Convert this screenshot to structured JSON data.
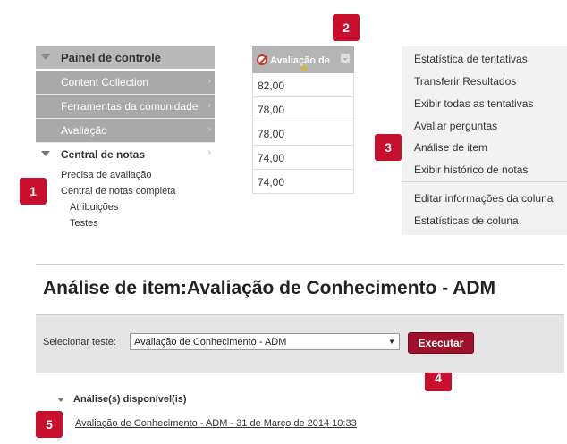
{
  "sidebar": {
    "header": "Painel de controle",
    "items": [
      {
        "label": "Content Collection"
      },
      {
        "label": "Ferramentas da comunidade"
      },
      {
        "label": "Avaliação"
      }
    ],
    "central": {
      "label": "Central de notas",
      "subitems": [
        "Precisa de avaliação",
        "Central de notas completa"
      ],
      "subsubitems": [
        "Atribuições",
        "Testes"
      ]
    }
  },
  "grade_column": {
    "header": "Avaliação de",
    "values": [
      "82,00",
      "78,00",
      "78,00",
      "74,00",
      "74,00"
    ]
  },
  "context_menu": {
    "items": [
      "Estatística de tentativas",
      "Transferir Resultados",
      "Exibir todas as tentativas",
      "Avaliar perguntas",
      "Análise de item",
      "Exibir histórico de notas",
      "Editar informações da coluna",
      "Estatísticas de coluna"
    ]
  },
  "badges": [
    "1",
    "2",
    "3",
    "4",
    "5"
  ],
  "analysis": {
    "title": "Análise de item:Avaliação de Conhecimento - ADM",
    "select_label": "Selecionar teste:",
    "select_value": "Avaliação de Conhecimento - ADM",
    "run_button": "Executar",
    "available_header": "Análise(s) disponível(is)",
    "report_link": "Avaliação de Conhecimento - ADM - 31 de Março de 2014 10:33"
  },
  "colors": {
    "accent": "#c8102e",
    "button": "#a0122b",
    "sidebar": "#a9a9a9"
  }
}
